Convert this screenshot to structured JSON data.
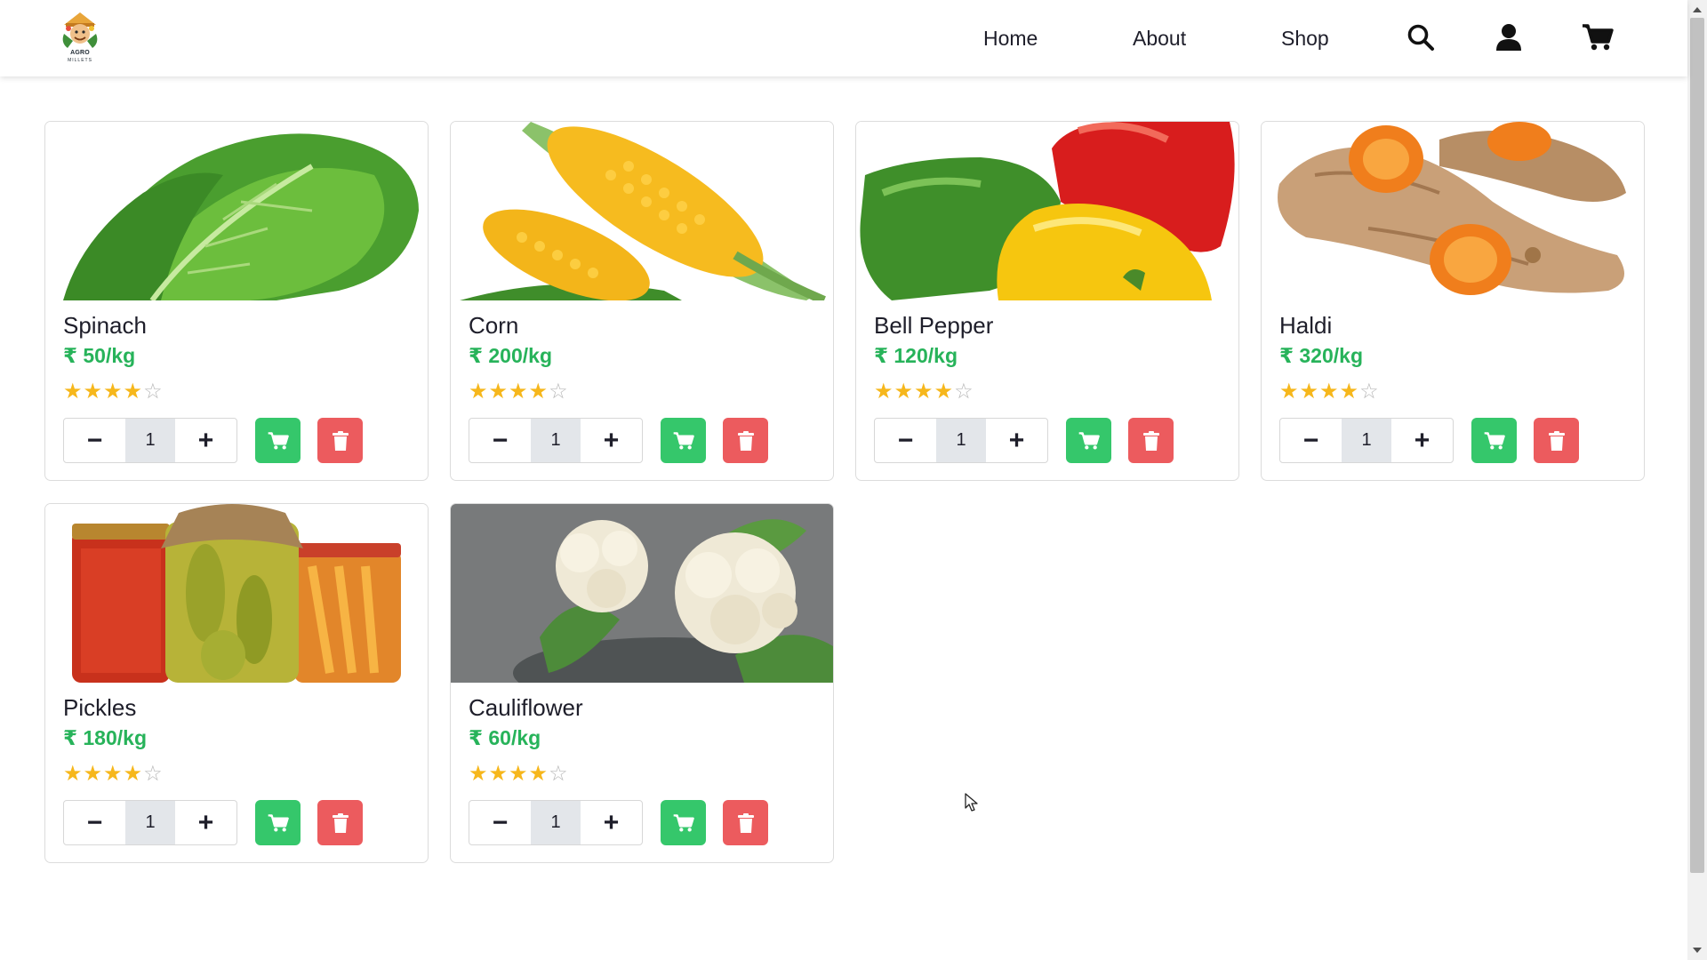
{
  "header": {
    "logo_text": "AGRO",
    "logo_subtext": "MILLETS",
    "nav": {
      "home": "Home",
      "about": "About",
      "shop": "Shop"
    },
    "icons": [
      "search-icon",
      "user-icon",
      "cart-icon"
    ]
  },
  "products": [
    {
      "name": "Spinach",
      "price": "₹ 50/kg",
      "rating": 4,
      "rating_max": 5,
      "quantity": "1"
    },
    {
      "name": "Corn",
      "price": "₹ 200/kg",
      "rating": 4,
      "rating_max": 5,
      "quantity": "1"
    },
    {
      "name": "Bell Pepper",
      "price": "₹ 120/kg",
      "rating": 4,
      "rating_max": 5,
      "quantity": "1"
    },
    {
      "name": "Haldi",
      "price": "₹ 320/kg",
      "rating": 4,
      "rating_max": 5,
      "quantity": "1"
    },
    {
      "name": "Pickles",
      "price": "₹ 180/kg",
      "rating": 4,
      "rating_max": 5,
      "quantity": "1"
    },
    {
      "name": "Cauliflower",
      "price": "₹ 60/kg",
      "rating": 4,
      "rating_max": 5,
      "quantity": "1"
    }
  ],
  "controls": {
    "decrement": "−",
    "increment": "+"
  },
  "colors": {
    "price": "#27b35a",
    "cart_button": "#35c76b",
    "delete_button": "#ec5b5e",
    "star": "#f6b71c",
    "quantity_bg": "#e3e6ea"
  }
}
